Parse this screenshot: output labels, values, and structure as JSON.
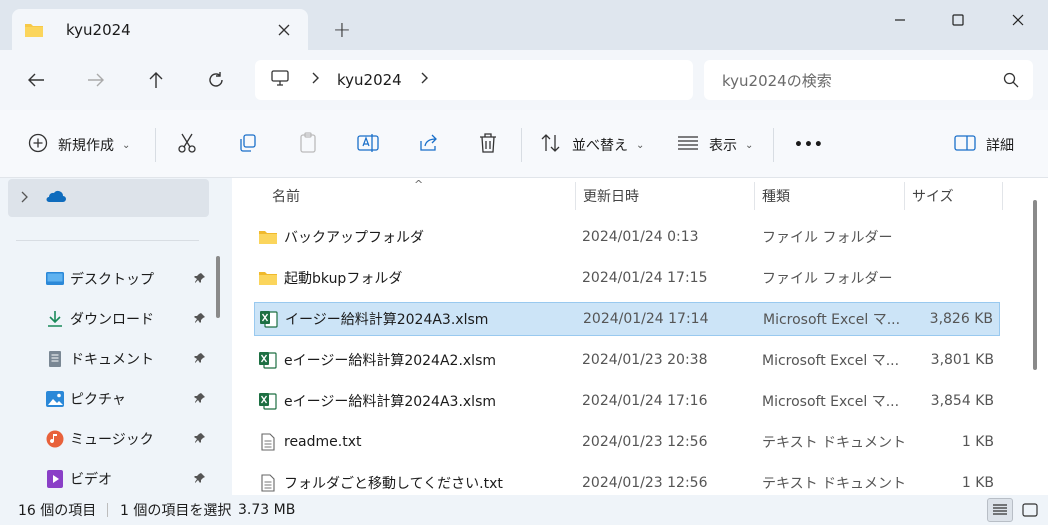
{
  "window": {
    "tab_title": "kyu2024",
    "new_tab_label": "+"
  },
  "address": {
    "crumbs": [
      "kyu2024"
    ],
    "search_placeholder": "kyu2024の検索"
  },
  "toolbar": {
    "new_label": "新規作成",
    "sort_label": "並べ替え",
    "view_label": "表示",
    "more_label": "•••",
    "details_label": "詳細"
  },
  "sidebar": {
    "items": [
      {
        "label": "デスクトップ",
        "icon": "desktop-icon"
      },
      {
        "label": "ダウンロード",
        "icon": "download-icon"
      },
      {
        "label": "ドキュメント",
        "icon": "document-icon"
      },
      {
        "label": "ピクチャ",
        "icon": "pictures-icon"
      },
      {
        "label": "ミュージック",
        "icon": "music-icon"
      },
      {
        "label": "ビデオ",
        "icon": "video-icon"
      }
    ]
  },
  "columns": {
    "name": "名前",
    "date": "更新日時",
    "type": "種類",
    "size": "サイズ"
  },
  "files": [
    {
      "name": "バックアップフォルダ",
      "date": "2024/01/24 0:13",
      "type": "ファイル フォルダー",
      "size": "",
      "icon": "folder-icon",
      "selected": false
    },
    {
      "name": "起動bkupフォルダ",
      "date": "2024/01/24 17:15",
      "type": "ファイル フォルダー",
      "size": "",
      "icon": "folder-icon",
      "selected": false
    },
    {
      "name": "イージー給料計算2024A3.xlsm",
      "date": "2024/01/24 17:14",
      "type": "Microsoft Excel マ...",
      "size": "3,826 KB",
      "icon": "excel-icon",
      "selected": true
    },
    {
      "name": "eイージー給料計算2024A2.xlsm",
      "date": "2024/01/23 20:38",
      "type": "Microsoft Excel マ...",
      "size": "3,801 KB",
      "icon": "excel-icon",
      "selected": false
    },
    {
      "name": "eイージー給料計算2024A3.xlsm",
      "date": "2024/01/24 17:16",
      "type": "Microsoft Excel マ...",
      "size": "3,854 KB",
      "icon": "excel-icon",
      "selected": false
    },
    {
      "name": "readme.txt",
      "date": "2024/01/23 12:56",
      "type": "テキスト ドキュメント",
      "size": "1 KB",
      "icon": "text-file-icon",
      "selected": false
    },
    {
      "name": "フォルダごと移動してください.txt",
      "date": "2024/01/23 12:56",
      "type": "テキスト ドキュメント",
      "size": "1 KB",
      "icon": "text-file-icon",
      "selected": false
    }
  ],
  "status": {
    "item_count": "16 個の項目",
    "selection": "1 個の項目を選択",
    "selection_size": "3.73 MB"
  },
  "colors": {
    "selection_bg": "#cce4f7",
    "selection_border": "#99c9ef",
    "folder": "#f7c948",
    "excel": "#1d6f42",
    "onedrive": "#0f6cbd"
  }
}
